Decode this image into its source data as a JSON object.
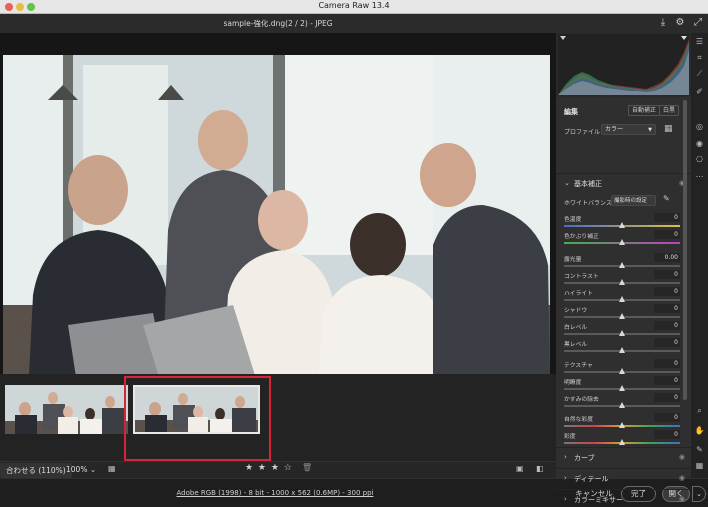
{
  "app": {
    "title": "Camera Raw 13.4"
  },
  "document": {
    "title": "sample-強化.dng(2 / 2)  -  JPEG"
  },
  "icons": {
    "save": "download-icon",
    "settings": "gear-icon",
    "fullscreen": "expand-icon"
  },
  "filmstrip": {
    "selected_index": 2,
    "rating_stars": "★ ★ ★ ☆",
    "highlight_color": "#d62335"
  },
  "status": {
    "fit_label": "合わせる (110%)",
    "zoom": "100%  ⌄"
  },
  "footer": {
    "info_link": "Adobe RGB (1998) - 8 bit - 1000 x 562 (0.6MP) - 300 ppi",
    "cancel": "キャンセル",
    "done": "完了",
    "open": "開く",
    "open_caret": "⌄"
  },
  "edit_panel": {
    "title": "編集",
    "auto_label": "自動補正",
    "bw_label": "白黒",
    "profile_label": "プロファイル",
    "profile_value": "カラー",
    "basic_header": "基本補正",
    "wb_label": "ホワイトバランス",
    "wb_value": "撮影時の設定",
    "sliders": [
      {
        "label": "色温度",
        "value": "0",
        "level": 0.5
      },
      {
        "label": "色かぶり補正",
        "value": "0",
        "level": 0.5
      },
      {
        "label": "露光量",
        "value": "0.00",
        "level": 0.5
      },
      {
        "label": "コントラスト",
        "value": "0",
        "level": 0.5
      },
      {
        "label": "ハイライト",
        "value": "0",
        "level": 0.5
      },
      {
        "label": "シャドウ",
        "value": "0",
        "level": 0.5
      },
      {
        "label": "白レベル",
        "value": "0",
        "level": 0.5
      },
      {
        "label": "黒レベル",
        "value": "0",
        "level": 0.5
      },
      {
        "label": "テクスチャ",
        "value": "0",
        "level": 0.5
      },
      {
        "label": "明瞭度",
        "value": "0",
        "level": 0.5
      },
      {
        "label": "かすみの除去",
        "value": "0",
        "level": 0.5
      },
      {
        "label": "自然な彩度",
        "value": "0",
        "level": 0.5
      },
      {
        "label": "彩度",
        "value": "0",
        "level": 0.5
      }
    ],
    "sections": [
      {
        "label": "カーブ"
      },
      {
        "label": "ディテール"
      },
      {
        "label": "カラーミキサー"
      }
    ]
  },
  "tool_rail": [
    "edit-sliders-icon",
    "crop-icon",
    "heal-brush-icon",
    "mask-icon",
    "red-eye-icon",
    "presets-icon",
    "snapshots-icon",
    "more-icon",
    "zoom-icon",
    "hand-icon",
    "color-sampler-icon",
    "grid-overlay-icon"
  ]
}
